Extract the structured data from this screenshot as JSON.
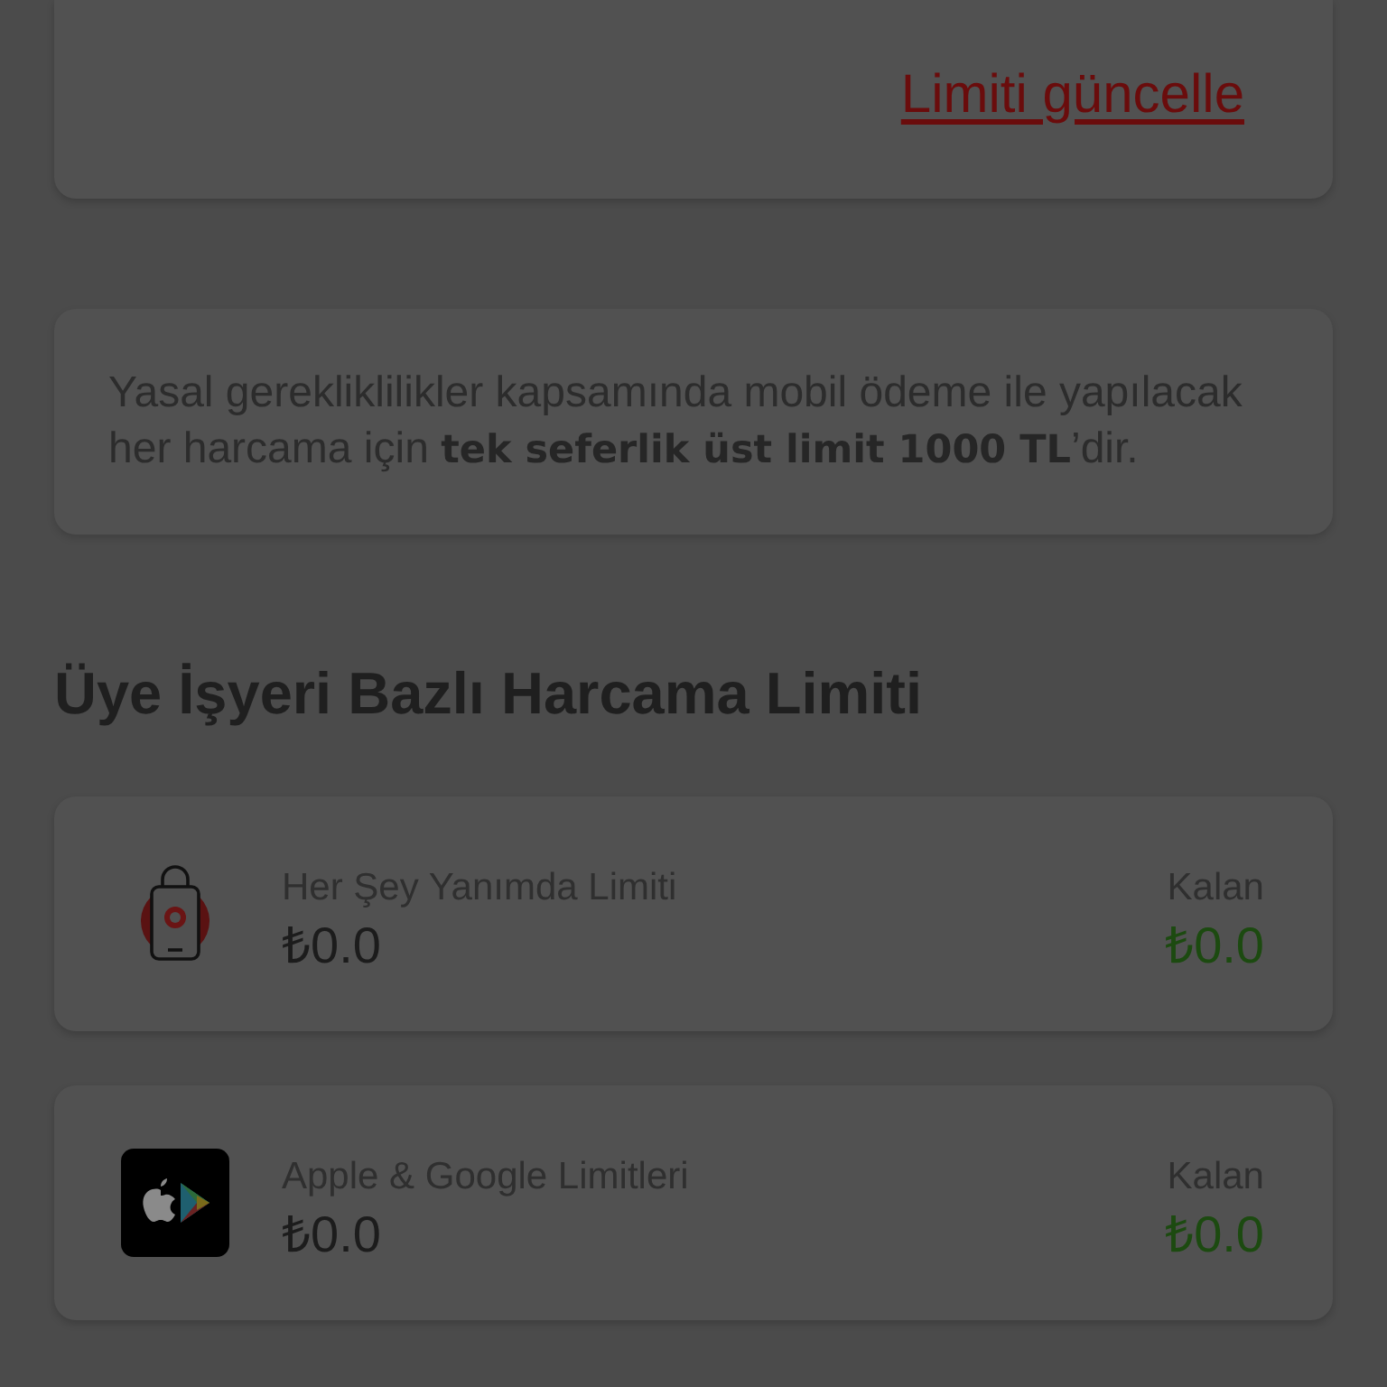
{
  "limit_card": {
    "update_link": "Limiti güncelle"
  },
  "notice": {
    "text": "Yasal gerekliklilikler kapsamında mobil ödeme ile yapılacak her harcama için **tek seferlik üst limit 1000 TL**’dir."
  },
  "section_title": "Üye İşyeri Bazlı Harcama Limiti",
  "merchant_limits": [
    {
      "kind": "shopping-bag",
      "title": "Her Şey Yanımda Limiti",
      "amount": "₺0.0",
      "remaining_label": "Kalan",
      "remaining": "₺0.0"
    },
    {
      "kind": "app-stores",
      "title": "Apple & Google Limitleri",
      "amount": "₺0.0",
      "remaining_label": "Kalan",
      "remaining": "₺0.0"
    }
  ]
}
